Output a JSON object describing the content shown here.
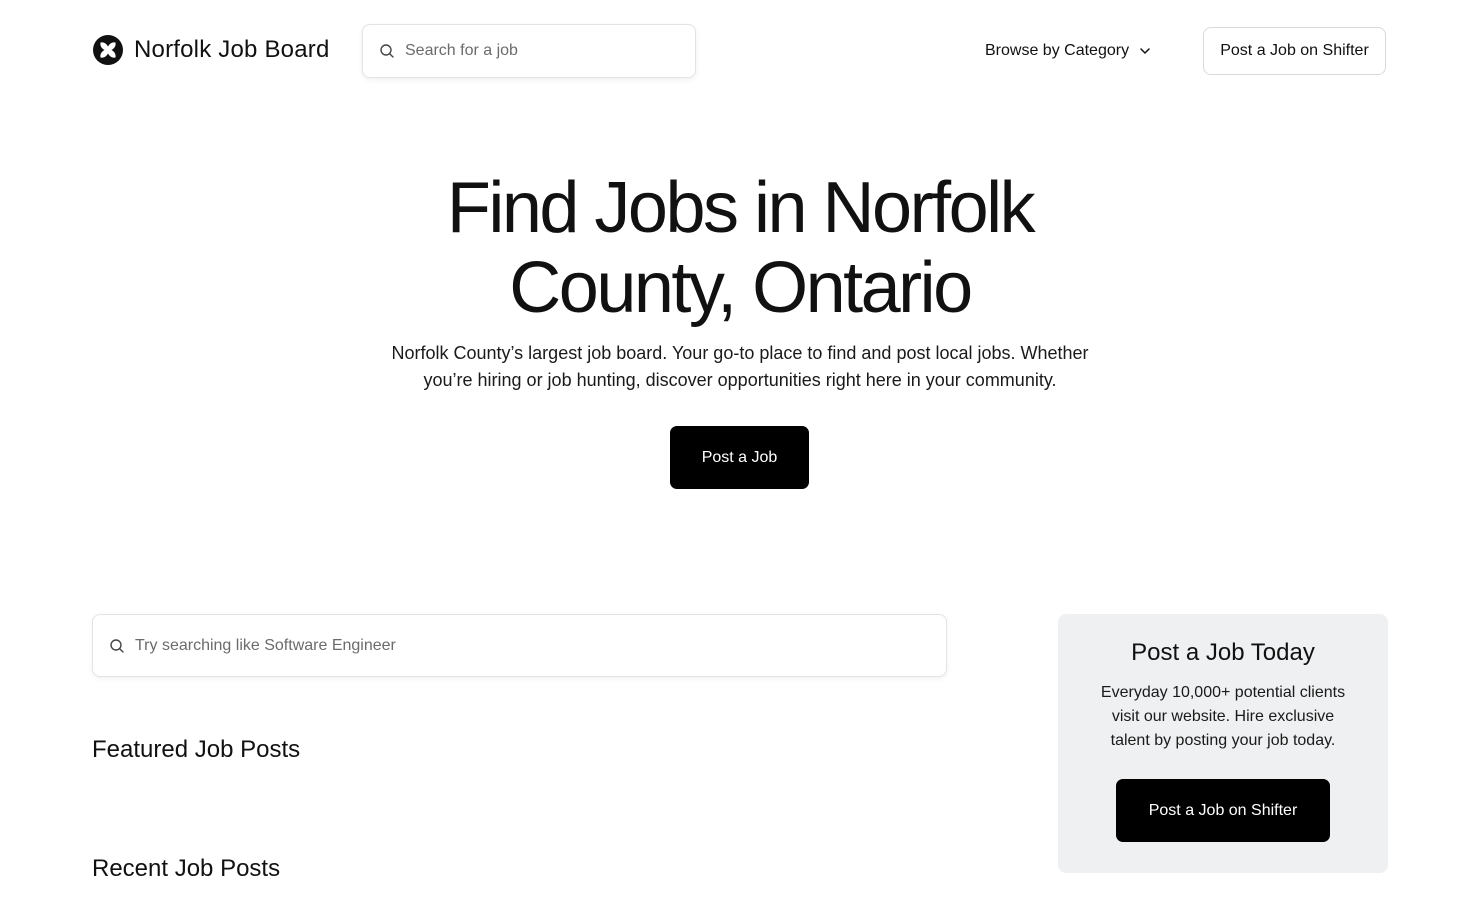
{
  "header": {
    "brand_name": "Norfolk Job Board",
    "brand_icon": "x-star-icon",
    "search_placeholder": "Search for a job",
    "browse_label": "Browse by Category",
    "post_shifter_label": "Post a Job on Shifter"
  },
  "hero": {
    "title_line1": "Find Jobs in Norfolk",
    "title_line2": "County, Ontario",
    "subtitle_line1": "Norfolk County’s largest job board. Your go-to place to find and post local jobs. Whether",
    "subtitle_line2": "you’re hiring or job hunting, discover opportunities right here in your community.",
    "cta_label": "Post a Job"
  },
  "main": {
    "search_placeholder": "Try searching like Software Engineer",
    "featured_title": "Featured Job Posts",
    "recent_title": "Recent Job Posts"
  },
  "sidebar": {
    "card_title": "Post a Job Today",
    "card_text_line1": "Everyday 10,000+ potential clients",
    "card_text_line2": "visit our website. Hire exclusive",
    "card_text_line3": "talent by posting your job today.",
    "card_button": "Post a Job on Shifter"
  },
  "colors": {
    "primary_button": "#000000",
    "card_background": "#eef0f1",
    "text": "#111111"
  }
}
